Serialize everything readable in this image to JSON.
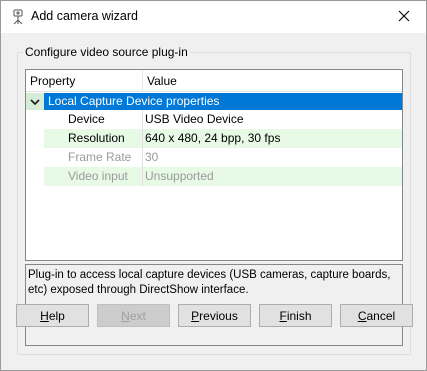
{
  "window": {
    "title": "Add camera wizard"
  },
  "group": {
    "label": "Configure video source plug-in"
  },
  "grid": {
    "headers": {
      "property": "Property",
      "value": "Value"
    },
    "category": {
      "label": "Local Capture Device properties",
      "icon": "chevron-down-icon"
    },
    "rows": [
      {
        "name": "Device",
        "value": "USB Video Device",
        "enabled": true
      },
      {
        "name": "Resolution",
        "value": "640 x 480, 24 bpp, 30 fps",
        "enabled": true
      },
      {
        "name": "Frame Rate",
        "value": "30",
        "enabled": false
      },
      {
        "name": "Video input",
        "value": "Unsupported",
        "enabled": false
      }
    ]
  },
  "description": "Plug-in to access local capture devices (USB cameras, capture boards, etc) exposed through DirectShow interface.",
  "buttons": {
    "help": {
      "mnemonic": "H",
      "rest": "elp"
    },
    "next": {
      "mnemonic": "N",
      "rest": "ext"
    },
    "previous": {
      "mnemonic": "P",
      "rest": "revious"
    },
    "finish": {
      "mnemonic": "F",
      "rest": "inish"
    },
    "cancel": {
      "mnemonic": "C",
      "rest": "ancel"
    }
  },
  "colors": {
    "selection": "#0078d7",
    "alt_row": "#e6fae6",
    "toggle_bg": "#d7ecd7",
    "dialog_bg": "#f0f0f0"
  }
}
